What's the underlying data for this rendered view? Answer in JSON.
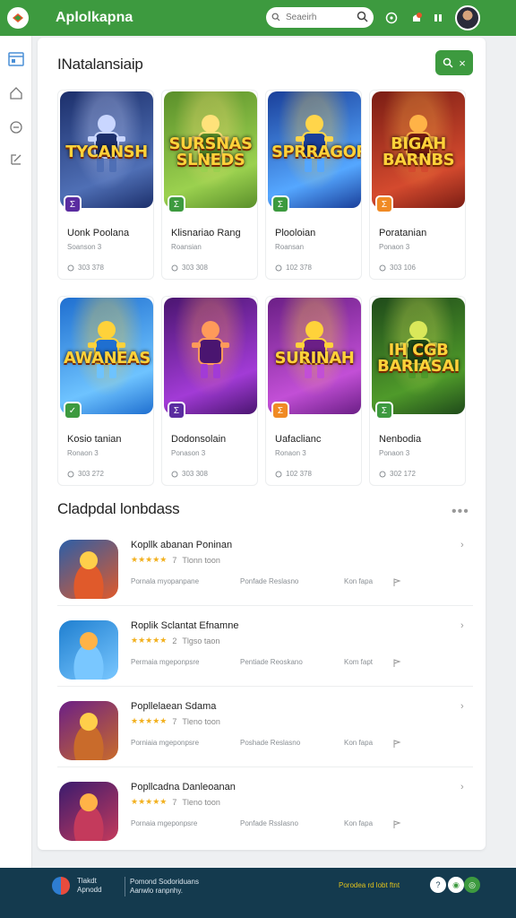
{
  "header": {
    "app_title": "Aplolkapna",
    "search_placeholder": "Seaeirh"
  },
  "featured": {
    "title": "INatalansiaip",
    "cards": [
      {
        "title": "Uonk Poolana",
        "subtitle": "Soanson 3",
        "meta": "303 378",
        "badge": "Σ",
        "badge_color": "#5a2ca0",
        "logo": "TYCANSH",
        "colors": [
          "#1c2f6b",
          "#4f6fb5",
          "#c9d6ff"
        ]
      },
      {
        "title": "Klisnariao Rang",
        "subtitle": "Roansian",
        "meta": "303 308",
        "badge": "Σ",
        "badge_color": "#3d9a3f",
        "logo": "SURSNAS SLNEDS",
        "colors": [
          "#5a8f2a",
          "#9bd14f",
          "#ffe27a"
        ]
      },
      {
        "title": "Plooloian",
        "subtitle": "Roansan",
        "meta": "102 378",
        "badge": "Σ",
        "badge_color": "#3d9a3f",
        "logo": "SPRRAGOR",
        "colors": [
          "#1a3f9a",
          "#55a7ff",
          "#ffd54a"
        ]
      },
      {
        "title": "Poratanian",
        "subtitle": "Ponaon 3",
        "meta": "303 106",
        "badge": "Σ",
        "badge_color": "#f08a24",
        "logo": "BIGAH BARNBS",
        "colors": [
          "#7a1d14",
          "#d44a2e",
          "#ffb347"
        ]
      },
      {
        "title": "Kosio tanian",
        "subtitle": "Ronaon 3",
        "meta": "303 272",
        "badge": "✓",
        "badge_color": "#3d9a3f",
        "logo": "AWANEAS",
        "colors": [
          "#1f6fd0",
          "#6ec3ff",
          "#ffd23a"
        ]
      },
      {
        "title": "Dodonsolain",
        "subtitle": "Ponason 3",
        "meta": "303 308",
        "badge": "Σ",
        "badge_color": "#5a2ca0",
        "logo": "",
        "colors": [
          "#4a1570",
          "#a23bd6",
          "#ff9a5a"
        ]
      },
      {
        "title": "Uafaclianc",
        "subtitle": "Ronaon 3",
        "meta": "102 378",
        "badge": "Σ",
        "badge_color": "#f08a24",
        "logo": "SURINAH",
        "colors": [
          "#6b1f86",
          "#c24fd6",
          "#ffd23a"
        ]
      },
      {
        "title": "Nenbodia",
        "subtitle": "Ponaon 3",
        "meta": "302 172",
        "badge": "Σ",
        "badge_color": "#3d9a3f",
        "logo": "IH CGB BARIASAI",
        "colors": [
          "#1f4a1a",
          "#4f9a2a",
          "#d9e85a"
        ]
      }
    ]
  },
  "trending": {
    "title": "Cladpdal lonbdass",
    "rows": [
      {
        "title": "Kopllk abanan Poninan",
        "rating_count": "7",
        "rating_text": "Tlonn toon",
        "meta1": "Pornala myopanpane",
        "meta2": "Ponfade Reslasno",
        "meta3": "Kon fapa",
        "colors": [
          "#2b5ea8",
          "#e05a2b",
          "#ffcf4a"
        ]
      },
      {
        "title": "Roplik Sclantat Efnamne",
        "rating_count": "2",
        "rating_text": "Tlgso taon",
        "meta1": "Permaia mgeponpsre",
        "meta2": "Pentiade Reoskano",
        "meta3": "Kom fapt",
        "colors": [
          "#1f7fd0",
          "#79c7ff",
          "#ffb347"
        ]
      },
      {
        "title": "Popllelaean Sdama",
        "rating_count": "7",
        "rating_text": "Tleno toon",
        "meta1": "Porniaia mgeponpsre",
        "meta2": "Poshade Reslasno",
        "meta3": "Kon fapa",
        "colors": [
          "#6b1f86",
          "#c96b2b",
          "#ffcf4a"
        ]
      },
      {
        "title": "Popllcadna Danleoanan",
        "rating_count": "7",
        "rating_text": "Tleno toon",
        "meta1": "Pornaia mgeponpsre",
        "meta2": "Ponfade Rsslasno",
        "meta3": "Kon fapa",
        "colors": [
          "#3a1b6e",
          "#c43a5c",
          "#ffb347"
        ]
      }
    ]
  },
  "footer": {
    "brand_line1": "Tlakdt",
    "brand_line2": "Apnodd",
    "text_line1": "Pomond Sodoriduans",
    "text_line2": "Aanwlo ranpnhy.",
    "green_text": "Porodea rd lobt ftnt"
  }
}
